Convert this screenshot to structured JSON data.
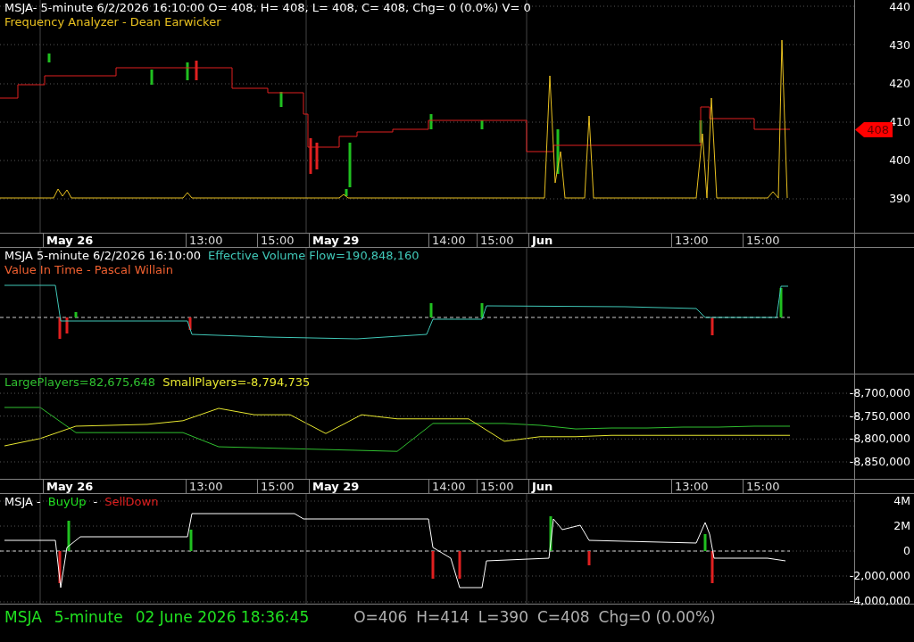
{
  "panels": [
    {
      "kind": "price",
      "header": [
        [
          {
            "text": "MSJA- 5-minute 6/2/2026 16:10:00 O= 408, H= 408, L= 408, C= 408, Chg= 0 (0.0%) V= 0"
          }
        ],
        [
          {
            "text": "Frequency Analyzer - Dean Earwicker",
            "color": "#e8c020"
          }
        ]
      ],
      "y_labels": [
        "440",
        "430",
        "420",
        "410",
        "400",
        "390"
      ],
      "price_tag": "408",
      "time_axis": [
        {
          "text": "May 26",
          "kind": "day"
        },
        {
          "text": "13:00",
          "kind": "time"
        },
        {
          "text": "15:00",
          "kind": "time"
        },
        {
          "text": "May 29",
          "kind": "day"
        },
        {
          "text": "14:00",
          "kind": "time"
        },
        {
          "text": "15:00",
          "kind": "time"
        },
        {
          "text": "Jun",
          "kind": "day"
        },
        {
          "text": "13:00",
          "kind": "time"
        },
        {
          "text": "15:00",
          "kind": "time"
        }
      ]
    },
    {
      "kind": "flow",
      "header": [
        [
          {
            "text": "MSJA 5-minute  6/2/2026 16:10:00"
          },
          {
            "text": "Effective Volume Flow=190,848,160",
            "color": "#40c8b8"
          }
        ],
        [
          {
            "text": "Value In Time - Pascal Willain",
            "color": "#f06030"
          }
        ]
      ]
    },
    {
      "kind": "players",
      "header": [
        [
          {
            "text": "LargePlayers=82,675,648",
            "color": "#30c030"
          },
          {
            "text": "SmallPlayers=-8,794,735",
            "color": "#e8e830"
          }
        ]
      ],
      "chart_data": {
        "type": "line",
        "ylim": [
          -8889000,
          -8659000
        ],
        "grid": true,
        "yticks": [
          {
            "value": -8700000,
            "label": "-8,700,000"
          },
          {
            "value": -8750000,
            "label": "-8,750,000"
          },
          {
            "value": -8800000,
            "label": "-8,800,000"
          },
          {
            "value": -8850000,
            "label": "-8,850,000"
          }
        ],
        "series": [
          {
            "color": "#30c030",
            "values": [
              -8731000,
              -8731000,
              -8786000,
              -8786000,
              -8786000,
              -8786000,
              -8817000,
              -8819000,
              -8821000,
              -8823000,
              -8825000,
              -8827000,
              -8766000,
              -8766000,
              -8766000,
              -8770000,
              -8778000,
              -8776000,
              -8776000,
              -8774000,
              -8774000,
              -8772000,
              -8772000
            ]
          },
          {
            "color": "#e8e830",
            "values": [
              -8815000,
              -8799000,
              -8772000,
              -8770000,
              -8768000,
              -8760000,
              -8733000,
              -8747000,
              -8747000,
              -8788000,
              -8747000,
              -8756000,
              -8756000,
              -8756000,
              -8805000,
              -8795000,
              -8795000,
              -8792000,
              -8792000,
              -8792000,
              -8792000,
              -8792000,
              -8792000
            ]
          }
        ]
      },
      "time_axis": [
        {
          "text": "May 26",
          "kind": "day"
        },
        {
          "text": "13:00",
          "kind": "time"
        },
        {
          "text": "15:00",
          "kind": "time"
        },
        {
          "text": "May 29",
          "kind": "day"
        },
        {
          "text": "14:00",
          "kind": "time"
        },
        {
          "text": "15:00",
          "kind": "time"
        },
        {
          "text": "Jun",
          "kind": "day"
        },
        {
          "text": "13:00",
          "kind": "time"
        },
        {
          "text": "15:00",
          "kind": "time"
        }
      ]
    },
    {
      "kind": "buysell",
      "header": [
        [
          {
            "text": "MSJA - "
          },
          {
            "text": "BuyUp",
            "color": "#20e020"
          },
          {
            "text": "-"
          },
          {
            "text": "SellDown",
            "color": "#e02020"
          }
        ]
      ],
      "y_labels": [
        "4M",
        "2M",
        "0",
        "-2,000,000",
        "-4,000,000"
      ]
    }
  ],
  "status_bar": {
    "symbol_info": [
      "MSJA",
      "5-minute",
      "02 June 2026 18:36:45"
    ],
    "quote": [
      "O=406",
      "H=414",
      "L=390",
      "C=408",
      "Chg=0 (0.00%)"
    ]
  }
}
